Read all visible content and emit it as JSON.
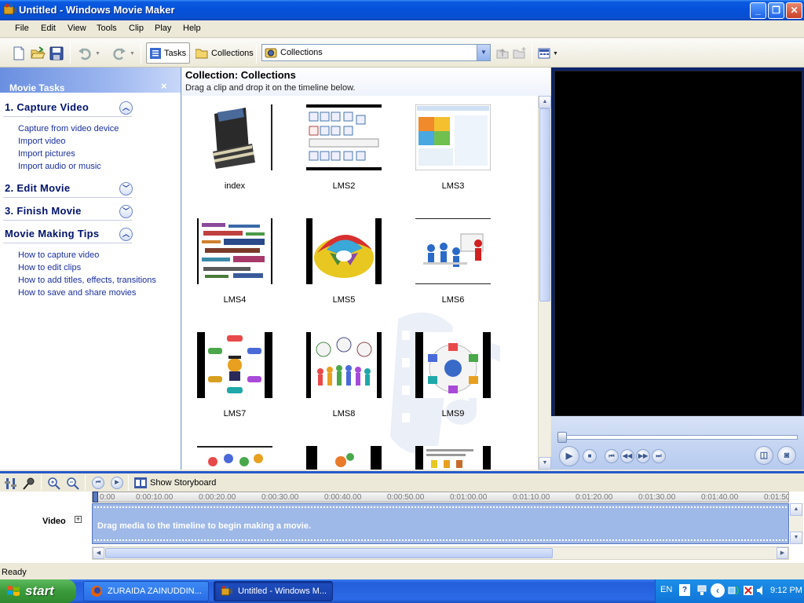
{
  "window": {
    "title": "Untitled - Windows Movie Maker",
    "minimize_glyph": "_",
    "maximize_glyph": "❐",
    "close_glyph": "✕"
  },
  "menu": [
    "File",
    "Edit",
    "View",
    "Tools",
    "Clip",
    "Play",
    "Help"
  ],
  "toolbar": {
    "tasks_label": "Tasks",
    "collections_label": "Collections",
    "collection_select_value": "Collections",
    "icons": [
      "new-project-icon",
      "open-project-icon",
      "save-project-icon",
      "undo-icon",
      "redo-icon",
      "up-folder-icon",
      "new-folder-icon",
      "views-icon"
    ]
  },
  "task_pane": {
    "title": "Movie Tasks",
    "close_glyph": "×",
    "sections": [
      {
        "title": "1. Capture Video",
        "expanded": true,
        "links": [
          "Capture from video device",
          "Import video",
          "Import pictures",
          "Import audio or music"
        ]
      },
      {
        "title": "2. Edit Movie",
        "expanded": false,
        "links": []
      },
      {
        "title": "3. Finish Movie",
        "expanded": false,
        "links": []
      },
      {
        "title": "Movie Making Tips",
        "expanded": true,
        "links": [
          "How to capture video",
          "How to edit clips",
          "How to add titles, effects, transitions",
          "How to save and share movies"
        ]
      }
    ]
  },
  "collection": {
    "title": "Collection: Collections",
    "subtitle": "Drag a clip and drop it on the timeline below.",
    "items": [
      {
        "label": "index"
      },
      {
        "label": "LMS2"
      },
      {
        "label": "LMS3"
      },
      {
        "label": "LMS4"
      },
      {
        "label": "LMS5"
      },
      {
        "label": "LMS6"
      },
      {
        "label": "LMS7"
      },
      {
        "label": "LMS8"
      },
      {
        "label": "LMS9"
      }
    ]
  },
  "timeline": {
    "show_storyboard_label": "Show Storyboard",
    "video_track_label": "Video",
    "expand_glyph": "+",
    "drop_hint": "Drag media to the timeline to begin making a movie.",
    "ruler_ticks": [
      "0:00",
      "0:00:10.00",
      "0:00:20.00",
      "0:00:30.00",
      "0:00:40.00",
      "0:00:50.00",
      "0:01:00.00",
      "0:01:10.00",
      "0:01:20.00",
      "0:01:30.00",
      "0:01:40.00",
      "0:01:50"
    ]
  },
  "status": {
    "text": "Ready"
  },
  "taskbar": {
    "start_label": "start",
    "buttons": [
      {
        "label": "ZURAIDA ZAINUDDIN..."
      },
      {
        "label": "Untitled - Windows M..."
      }
    ],
    "language": "EN",
    "clock": "9:12 PM"
  },
  "colors": {
    "xp_blue": "#0a5ae0",
    "task_link": "#1a2f9e",
    "section_title": "#00136b",
    "timeline_track": "#9eb8e8"
  }
}
